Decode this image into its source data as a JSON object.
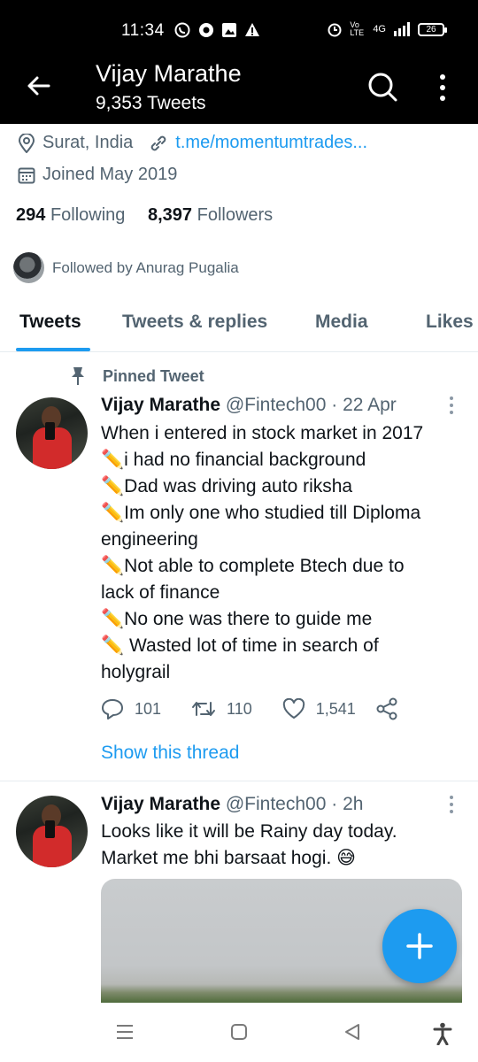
{
  "status_bar": {
    "time": "11:34",
    "network": "4G",
    "volte": "Vo LTE",
    "battery": "26",
    "left_icons": [
      "whatsapp-icon",
      "chrome-icon",
      "gallery-icon",
      "warning-icon"
    ],
    "right_icons": [
      "alarm-icon",
      "signal-icon",
      "battery-icon"
    ]
  },
  "header": {
    "name": "Vijay Marathe",
    "tweet_count": "9,353 Tweets"
  },
  "profile": {
    "location": "Surat, India",
    "link": "t.me/momentumtrades...",
    "joined": "Joined May 2019",
    "following_count": "294",
    "following_label": "Following",
    "followers_count": "8,397",
    "followers_label": "Followers",
    "followed_by": "Followed by Anurag Pugalia"
  },
  "tabs": [
    {
      "label": "Tweets",
      "active": true
    },
    {
      "label": "Tweets & replies",
      "active": false
    },
    {
      "label": "Media",
      "active": false
    },
    {
      "label": "Likes",
      "active": false
    }
  ],
  "tweets": [
    {
      "pinned_label": "Pinned Tweet",
      "name": "Vijay Marathe",
      "handle_time": "@Fintech00 · 22 Apr",
      "lines": [
        "When i entered in stock market in 2017",
        "✏️i had no financial background",
        "✏️Dad was driving auto riksha",
        "✏️Im only one who studied till Diploma",
        "engineering",
        "✏️Not able to complete Btech due to",
        "lack of finance",
        "✏️No one was there to guide me",
        "✏️ Wasted lot of time in search of",
        "holygrail"
      ],
      "replies": "101",
      "retweets": "110",
      "likes": "1,541",
      "show_thread": "Show this thread"
    },
    {
      "name": "Vijay Marathe",
      "handle_time": "@Fintech00 · 2h",
      "lines": [
        "Looks like it will be Rainy day today.",
        "Market me bhi barsaat hogi. 😅"
      ]
    }
  ],
  "colors": {
    "accent": "#1d9bf0",
    "header_bg": "#000000",
    "secondary_text": "#536471"
  }
}
